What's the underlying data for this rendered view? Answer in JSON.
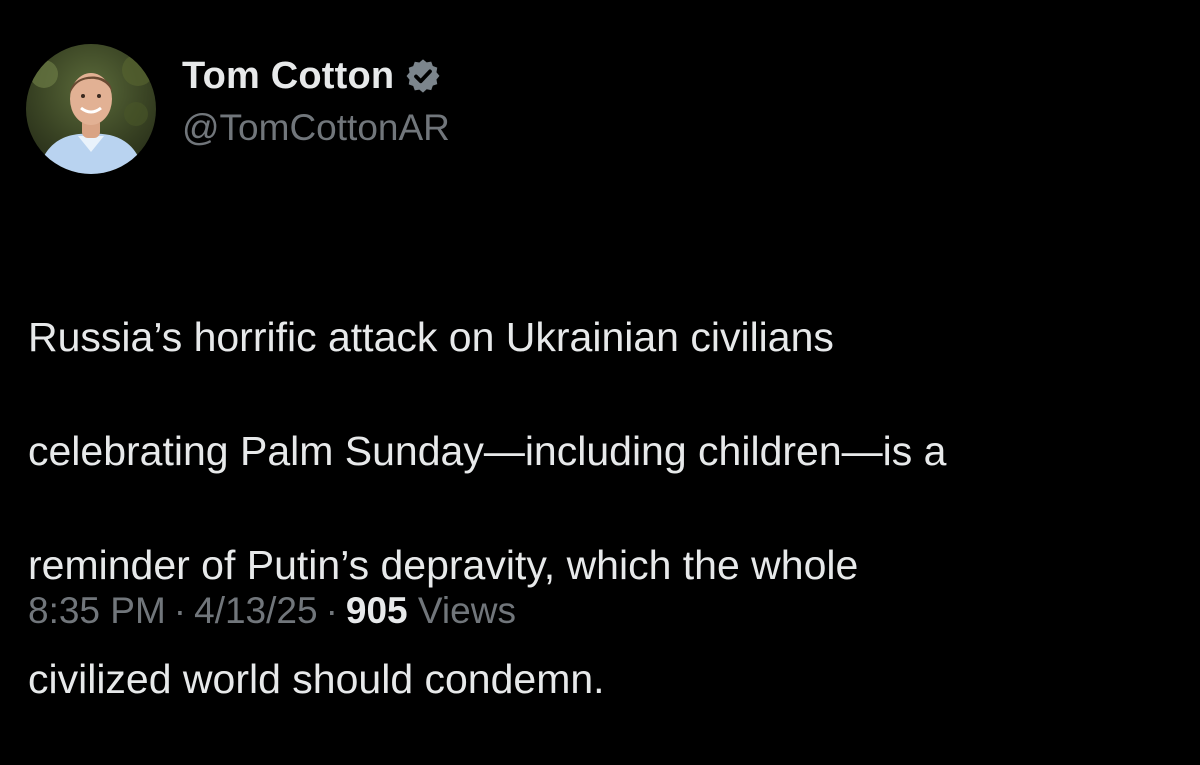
{
  "tweet": {
    "author": {
      "display_name": "Tom Cotton",
      "handle": "@TomCottonAR",
      "verified_icon": "verified-badge-icon",
      "verified_color": "#71767b"
    },
    "text_lines": [
      "Russia’s horrific attack on Ukrainian civilians",
      "celebrating Palm Sunday—including children—is a",
      "reminder of Putin’s depravity, which the whole",
      "civilized world should condemn."
    ],
    "meta": {
      "time": "8:35 PM",
      "date": "4/13/25",
      "separator": "·",
      "views_count": "905",
      "views_label": "Views"
    }
  },
  "colors": {
    "background": "#000000",
    "primary_text": "#e7e9ea",
    "secondary_text": "#71767b"
  }
}
